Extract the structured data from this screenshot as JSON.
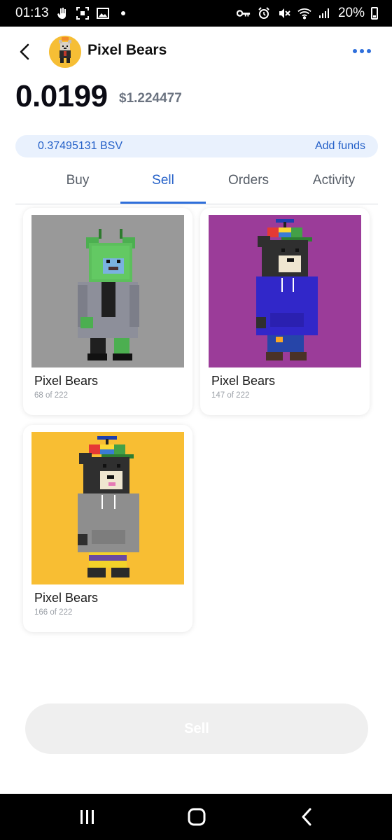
{
  "status_bar": {
    "time": "01:13",
    "battery": "20%",
    "left_icons": [
      "hand-icon",
      "screenshot-icon",
      "gallery-icon",
      "dot-icon"
    ],
    "right_icons": [
      "key-icon",
      "alarm-icon",
      "mute-icon",
      "wifi-icon",
      "signal-icon",
      "battery-icon"
    ]
  },
  "header": {
    "title": "Pixel Bears",
    "avatar_icon": "pixel-bear-avatar"
  },
  "price": {
    "amount": "0.0199",
    "usd": "$1.224477"
  },
  "balance": {
    "amount": "0.37495131 BSV",
    "action": "Add funds"
  },
  "tabs": [
    {
      "label": "Buy",
      "active": false
    },
    {
      "label": "Sell",
      "active": true
    },
    {
      "label": "Orders",
      "active": false
    },
    {
      "label": "Activity",
      "active": false
    }
  ],
  "items": [
    {
      "title": "Pixel Bears",
      "subtitle": "68 of 222",
      "background": "#999999",
      "bear": "green-alien-bear"
    },
    {
      "title": "Pixel Bears",
      "subtitle": "147 of 222",
      "background": "#9b3c99",
      "bear": "black-bear-blue-hoodie"
    },
    {
      "title": "Pixel Bears",
      "subtitle": "166 of 222",
      "background": "#f8be33",
      "bear": "black-bear-grey-hoodie"
    }
  ],
  "sell_button": {
    "label": "Sell"
  },
  "colors": {
    "accent": "#2f6fdb",
    "balance_bg": "#e9f1fd",
    "button_disabled": "#efefef"
  },
  "nav_bar": {
    "icons": [
      "recents-icon",
      "home-icon",
      "back-icon"
    ]
  }
}
